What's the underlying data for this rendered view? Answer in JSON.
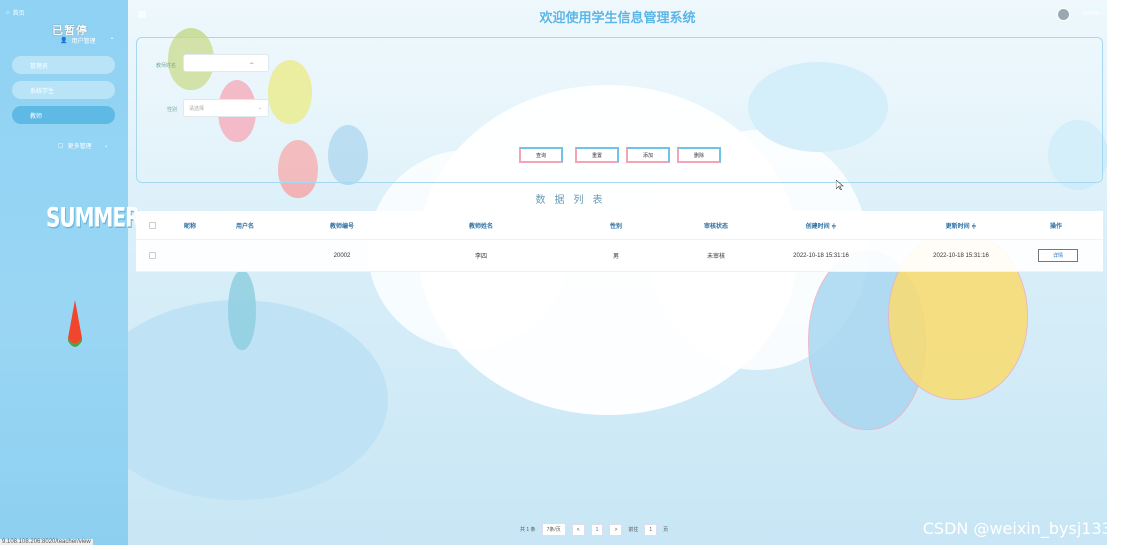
{
  "app": {
    "title": "欢迎使用学生信息管理系统",
    "user": "admin"
  },
  "sidebar": {
    "home": "首页",
    "logo": "已暂停",
    "user_mgmt": "用户管理",
    "items": [
      {
        "label": "管理员",
        "active": false
      },
      {
        "label": "系统学生",
        "active": false
      },
      {
        "label": "教师",
        "active": true
      }
    ],
    "more": "更多管理",
    "decor_text": "SUMMER"
  },
  "search": {
    "fields": [
      {
        "label": "教师姓名",
        "placeholder": "",
        "value": ""
      },
      {
        "label": "性别",
        "placeholder": "请选择",
        "value": ""
      }
    ],
    "buttons": [
      "查询",
      "重置",
      "添加",
      "删除"
    ]
  },
  "table": {
    "title": "数据列表",
    "columns": [
      "昵称",
      "用户名",
      "教师编号",
      "教师姓名",
      "性别",
      "审核状态",
      "创建时间 ≑",
      "更新时间 ≑",
      "操作"
    ],
    "rows": [
      {
        "nickname": "",
        "username": "",
        "teacher_no": "20002",
        "teacher_name": "李四",
        "gender": "男",
        "status": "未审核",
        "created": "2022-10-18 15:31:16",
        "updated": "2022-10-18 15:31:16",
        "action": "详情"
      }
    ]
  },
  "pager": {
    "total": "共 1 条",
    "page_size": "7条/页",
    "current_page": "1",
    "goto_label": "前往",
    "goto_value": "1",
    "page_unit": "页",
    "prev": "<",
    "next": ">"
  },
  "status_url": "9.108.108.206:8020/teacher/view",
  "watermark": "CSDN @weixin_bysj1330"
}
